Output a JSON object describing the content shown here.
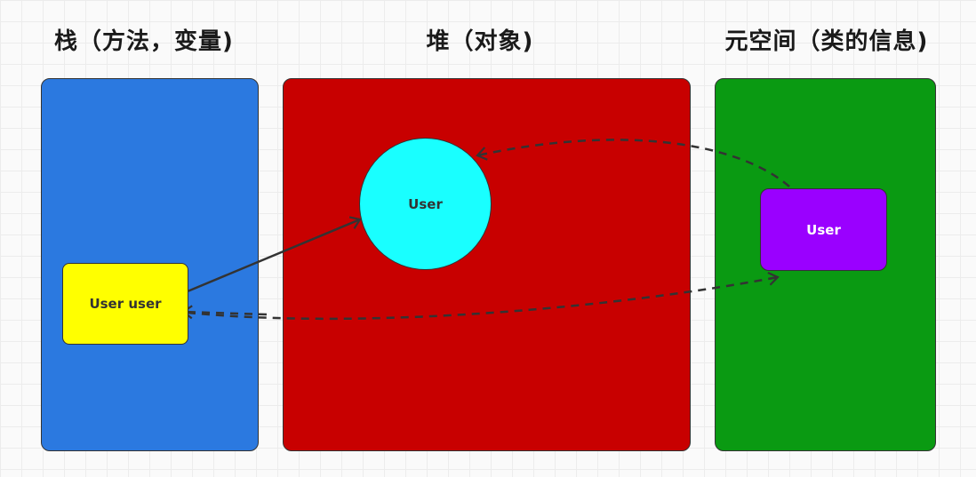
{
  "headings": {
    "stack": "栈（方法，变量)",
    "heap": "堆（对象)",
    "metaspace": "元空间（类的信息)"
  },
  "nodes": {
    "stack_variable": "User user",
    "heap_object": "User",
    "metaspace_class": "User"
  },
  "colors": {
    "stack_region": "#2b79e0",
    "heap_region": "#c80000",
    "metaspace_region": "#0a9a12",
    "stack_variable": "#ffff00",
    "heap_object": "#19ffff",
    "metaspace_class": "#9a00ff",
    "connector": "#333333"
  }
}
